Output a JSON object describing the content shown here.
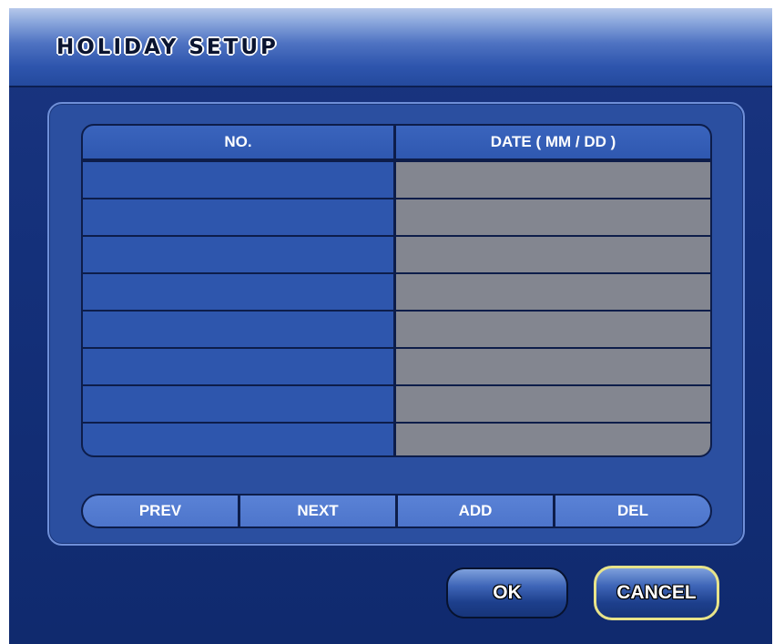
{
  "window": {
    "title": "HOLIDAY SETUP"
  },
  "table": {
    "columns": [
      "NO.",
      "DATE ( MM / DD )"
    ],
    "rows": [
      {
        "no": "",
        "date": ""
      },
      {
        "no": "",
        "date": ""
      },
      {
        "no": "",
        "date": ""
      },
      {
        "no": "",
        "date": ""
      },
      {
        "no": "",
        "date": ""
      },
      {
        "no": "",
        "date": ""
      },
      {
        "no": "",
        "date": ""
      },
      {
        "no": "",
        "date": ""
      }
    ]
  },
  "nav_buttons": {
    "prev": "PREV",
    "next": "NEXT",
    "add": "ADD",
    "del": "DEL"
  },
  "actions": {
    "ok": "OK",
    "cancel": "CANCEL"
  },
  "colors": {
    "window_bg": "#14307a",
    "panel_bg": "#2b4fa0",
    "date_cell_bg": "#838690",
    "cancel_focus_border": "#e8e48a"
  }
}
